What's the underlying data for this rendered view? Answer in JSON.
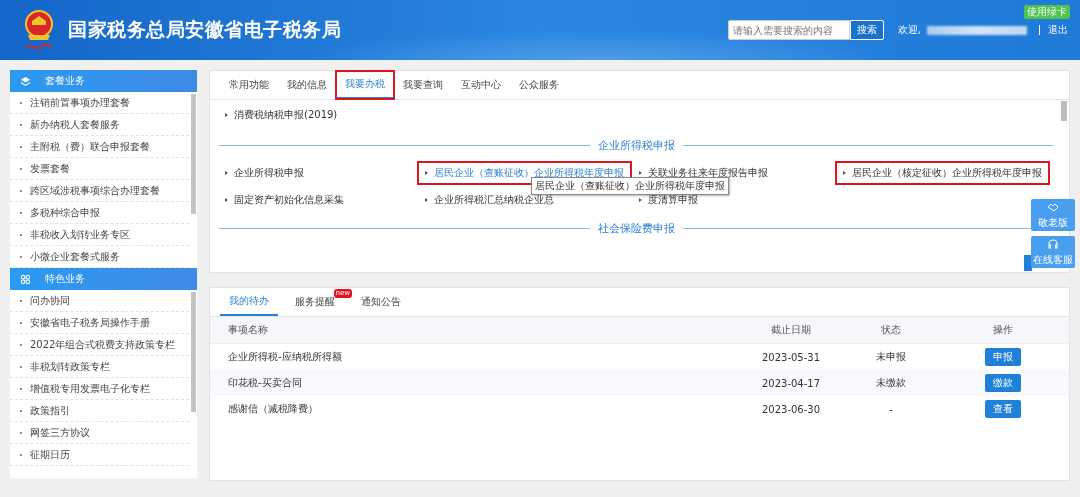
{
  "header": {
    "title": "国家税务总局安徽省电子税务局",
    "search": {
      "placeholder": "请输入需要搜索的内容",
      "button": "搜索"
    },
    "greeting": "欢迎,",
    "logout": "退出",
    "badge": "使用绿卡"
  },
  "sidebar": {
    "sections": [
      {
        "title": "套餐业务",
        "items": [
          "注销前置事项办理套餐",
          "新办纳税人套餐服务",
          "主附税（费）联合申报套餐",
          "发票套餐",
          "跨区域涉税事项综合办理套餐",
          "多税种综合申报",
          "非税收入划转业务专区",
          "小微企业套餐式服务"
        ]
      },
      {
        "title": "特色业务",
        "items": [
          "问办协同",
          "安徽省电子税务局操作手册",
          "2022年组合式税费支持政策专栏",
          "非税划转政策专栏",
          "增值税专用发票电子化专栏",
          "政策指引",
          "网签三方协议",
          "征期日历"
        ]
      }
    ]
  },
  "main_tabs": [
    {
      "label": "常用功能",
      "selected": false,
      "highlighted": false
    },
    {
      "label": "我的信息",
      "selected": false,
      "highlighted": false
    },
    {
      "label": "我要办税",
      "selected": true,
      "highlighted": true
    },
    {
      "label": "我要查询",
      "selected": false,
      "highlighted": false
    },
    {
      "label": "互动中心",
      "selected": false,
      "highlighted": false
    },
    {
      "label": "公众服务",
      "selected": false,
      "highlighted": false
    }
  ],
  "top_item": "消费税纳税申报(2019)",
  "sections": [
    {
      "title": "企业所得税申报",
      "items": [
        {
          "label": "企业所得税申报",
          "highlighted": false,
          "hovered": false
        },
        {
          "label": "居民企业（查账征收）企业所得税年度申报",
          "highlighted": true,
          "hovered": true
        },
        {
          "label": "关联业务往来年度报告申报",
          "highlighted": false,
          "hovered": false
        },
        {
          "label": "居民企业（核定征收）企业所得税年度申报",
          "highlighted": true,
          "hovered": false
        },
        {
          "label": "固定资产初始化信息采集",
          "highlighted": false,
          "hovered": false
        },
        {
          "label": "企业所得税汇总纳税企业总",
          "highlighted": false,
          "hovered": false
        },
        {
          "label": "度清算申报",
          "highlighted": false,
          "hovered": false
        }
      ]
    },
    {
      "title": "社会保险费申报"
    }
  ],
  "tooltip": "居民企业（查账征收）企业所得税年度申报",
  "floating_buttons": [
    {
      "label": "敬老版",
      "kind": "elder"
    },
    {
      "label": "在线客服",
      "kind": "service"
    }
  ],
  "todo_tabs": [
    {
      "label": "我的待办",
      "selected": true
    },
    {
      "label": "服务提醒",
      "selected": false,
      "badge": "new"
    },
    {
      "label": "通知公告",
      "selected": false
    }
  ],
  "table": {
    "columns": [
      "事项名称",
      "截止日期",
      "状态",
      "操作"
    ],
    "rows": [
      {
        "name": "企业所得税-应纳税所得额",
        "date": "2023-05-31",
        "status": "未申报",
        "action": "申报"
      },
      {
        "name": "印花税-买卖合同",
        "date": "2023-04-17",
        "status": "未缴款",
        "action": "缴款"
      },
      {
        "name": "感谢信（减税降费）",
        "date": "2023-06-30",
        "status": "-",
        "action": "查看"
      }
    ]
  }
}
